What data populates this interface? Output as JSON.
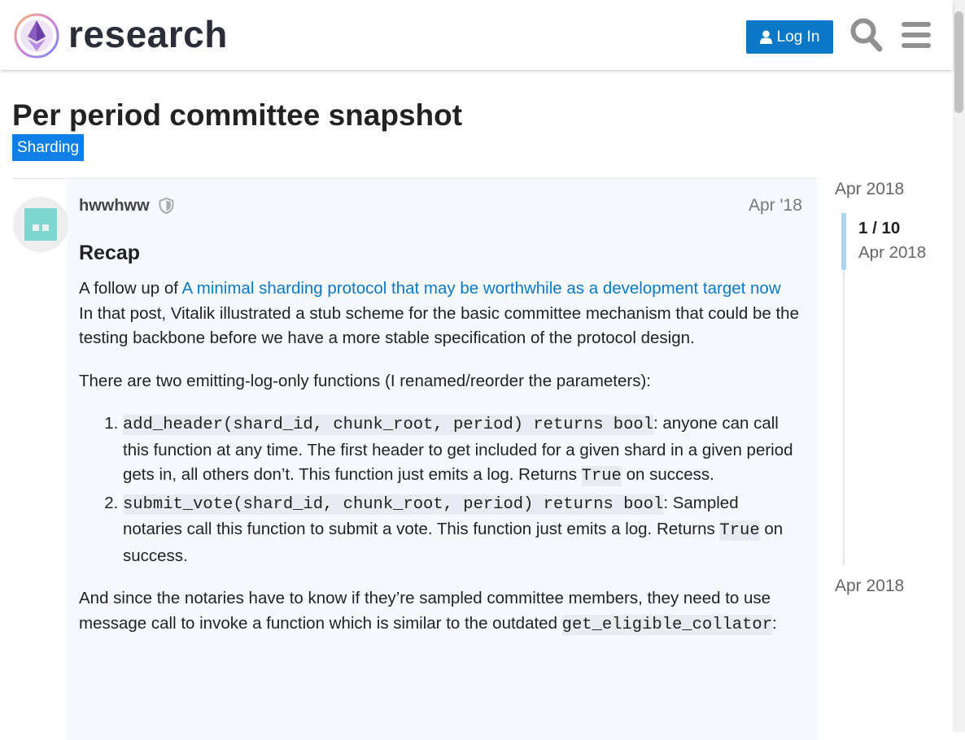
{
  "header": {
    "site_name": "research",
    "login_label": "Log In"
  },
  "topic": {
    "title": "Per period committee snapshot",
    "category": "Sharding"
  },
  "post": {
    "username": "hwwhww",
    "date": "Apr '18",
    "heading": "Recap",
    "intro_prefix": "A follow up of ",
    "intro_link": "A minimal sharding protocol that may be worthwhile as a development target now",
    "intro_rest": "In that post, Vitalik illustrated a stub scheme for the basic committee mechanism that could be the testing backbone before we have a more stable specification of the protocol design.",
    "functions_intro": "There are two emitting-log-only functions (I renamed/reorder the parameters):",
    "item1_code": "add_header(shard_id, chunk_root, period) returns bool",
    "item1_text": ": anyone can call this function at any time. The first header to get included for a given shard in a given period gets in, all others don’t. This function just emits a log. Returns ",
    "item1_code2": "True",
    "item1_end": " on success.",
    "item2_code": "submit_vote(shard_id, chunk_root, period) returns bool",
    "item2_text": ": Sampled notaries call this function to submit a vote. This function just emits a log. Returns ",
    "item2_code2": "True",
    "item2_end": " on success.",
    "notaries_text": "And since the notaries have to know if they’re sampled committee members, they need to use message call to invoke a function which is similar to the outdated ",
    "notaries_code": "get_eligible_collator",
    "notaries_end": ":"
  },
  "timeline": {
    "start": "Apr 2018",
    "position": "1 / 10",
    "current_date": "Apr 2018",
    "end": "Apr 2018",
    "progress": 0.1
  },
  "colors": {
    "accent": "#0a78c6",
    "category": "#0e7fe8",
    "post_bg": "#f6f9fd"
  },
  "icons": [
    "research-logo-icon",
    "user-icon",
    "search-icon",
    "hamburger-menu-icon",
    "shield-icon",
    "avatar-icon"
  ]
}
